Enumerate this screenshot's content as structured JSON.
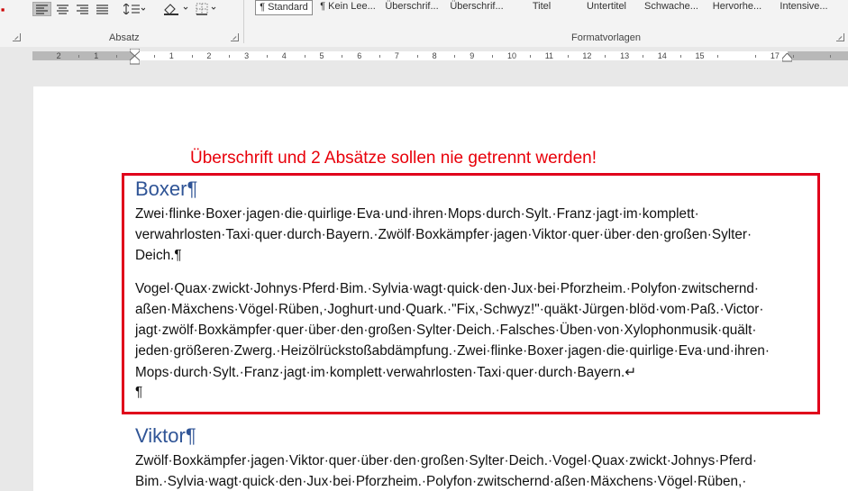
{
  "ribbon": {
    "paragraph_group_label": "Absatz",
    "styles_group_label": "Formatvorlagen",
    "styles": [
      {
        "label": "¶ Standard",
        "selected": true
      },
      {
        "label": "¶ Kein Lee...",
        "selected": false
      },
      {
        "label": "Überschrif...",
        "selected": false
      },
      {
        "label": "Überschrif...",
        "selected": false
      },
      {
        "label": "Titel",
        "selected": false
      },
      {
        "label": "Untertitel",
        "selected": false
      },
      {
        "label": "Schwache...",
        "selected": false
      },
      {
        "label": "Hervorhe...",
        "selected": false
      },
      {
        "label": "Intensive...",
        "selected": false
      }
    ],
    "icons": [
      "align-left-icon",
      "align-center-icon",
      "align-right-icon",
      "justify-icon",
      "line-spacing-icon",
      "shading-icon",
      "borders-icon"
    ]
  },
  "ruler": {
    "numbers": [
      "2",
      "1",
      "1",
      "2",
      "3",
      "4",
      "5",
      "6",
      "7",
      "8",
      "9",
      "10",
      "11",
      "12",
      "13",
      "14",
      "15",
      "17"
    ]
  },
  "document": {
    "annotation": "Überschrift und 2 Absätze sollen nie getrennt werden!",
    "heading1": "Boxer",
    "heading1_mark": "¶",
    "para1_lines": [
      "Zwei·flinke·Boxer·jagen·die·quirlige·Eva·und·ihren·Mops·durch·Sylt.·Franz·jagt·im·komplett·",
      "verwahrlosten·Taxi·quer·durch·Bayern.·Zwölf·Boxkämpfer·jagen·Viktor·quer·über·den·großen·Sylter·",
      "Deich.¶"
    ],
    "para2_lines": [
      "Vogel·Quax·zwickt·Johnys·Pferd·Bim.·Sylvia·wagt·quick·den·Jux·bei·Pforzheim.·Polyfon·zwitschernd·",
      "aßen·Mäxchens·Vögel·Rüben,·Joghurt·und·Quark.·\"Fix,·Schwyz!\"·quäkt·Jürgen·blöd·vom·Paß.·Victor·",
      "jagt·zwölf·Boxkämpfer·quer·über·den·großen·Sylter·Deich.·Falsches·Üben·von·Xylophonmusik·quält·",
      "jeden·größeren·Zwerg.·Heizölrückstoßabdämpfung.·Zwei·flinke·Boxer·jagen·die·quirlige·Eva·und·ihren·",
      "Mops·durch·Sylt.·Franz·jagt·im·komplett·verwahrlosten·Taxi·quer·durch·Bayern.↵",
      "¶"
    ],
    "heading2": "Viktor",
    "heading2_mark": "¶",
    "para3_lines": [
      "Zwölf·Boxkämpfer·jagen·Viktor·quer·über·den·großen·Sylter·Deich.·Vogel·Quax·zwickt·Johnys·Pferd·",
      "Bim.·Sylvia·wagt·quick·den·Jux·bei·Pforzheim.·Polyfon·zwitschernd·aßen·Mäxchens·Vögel·Rüben,·"
    ]
  }
}
